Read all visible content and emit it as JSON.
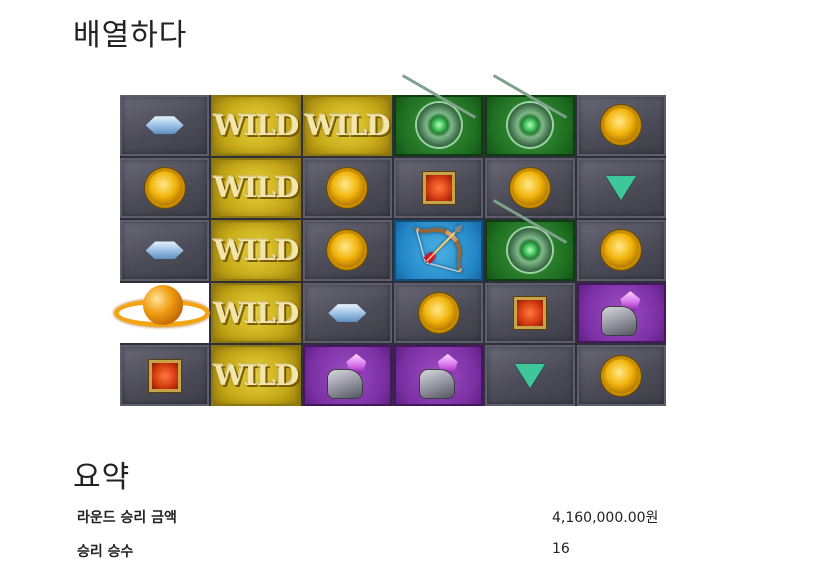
{
  "title": "배열하다",
  "grid": {
    "columns": 6,
    "rows": 5,
    "cells": [
      {
        "symbol": "blue-diamond-icon",
        "bg": "stone"
      },
      {
        "symbol": "wild",
        "label": "WILD",
        "bg": "wild"
      },
      {
        "symbol": "wild",
        "label": "WILD",
        "bg": "wild"
      },
      {
        "symbol": "green-shield-icon",
        "bg": "green"
      },
      {
        "symbol": "green-shield-icon",
        "bg": "green"
      },
      {
        "symbol": "gold-coin-icon",
        "bg": "stone"
      },
      {
        "symbol": "gold-coin-icon",
        "bg": "stone"
      },
      {
        "symbol": "wild",
        "label": "WILD",
        "bg": "wild"
      },
      {
        "symbol": "gold-coin-icon",
        "bg": "stone"
      },
      {
        "symbol": "red-square-gem-icon",
        "bg": "stone"
      },
      {
        "symbol": "gold-coin-icon",
        "bg": "stone"
      },
      {
        "symbol": "green-triangle-gem-icon",
        "bg": "stone"
      },
      {
        "symbol": "blue-diamond-icon",
        "bg": "stone"
      },
      {
        "symbol": "wild",
        "label": "WILD",
        "bg": "wild"
      },
      {
        "symbol": "gold-coin-icon",
        "bg": "stone"
      },
      {
        "symbol": "bow-arrow-icon",
        "bg": "blue"
      },
      {
        "symbol": "green-shield-icon",
        "bg": "green"
      },
      {
        "symbol": "gold-coin-icon",
        "bg": "stone"
      },
      {
        "symbol": "golden-orb-icon",
        "bg": "orb"
      },
      {
        "symbol": "wild",
        "label": "WILD",
        "bg": "wild"
      },
      {
        "symbol": "blue-diamond-icon",
        "bg": "stone"
      },
      {
        "symbol": "gold-coin-icon",
        "bg": "stone"
      },
      {
        "symbol": "red-square-gem-icon",
        "bg": "stone"
      },
      {
        "symbol": "crystal-helmet-icon",
        "bg": "purple"
      },
      {
        "symbol": "red-square-gem-icon",
        "bg": "stone"
      },
      {
        "symbol": "wild",
        "label": "WILD",
        "bg": "wild"
      },
      {
        "symbol": "crystal-helmet-icon",
        "bg": "purple"
      },
      {
        "symbol": "crystal-helmet-icon",
        "bg": "purple"
      },
      {
        "symbol": "green-triangle-gem-icon",
        "bg": "stone"
      },
      {
        "symbol": "gold-coin-icon",
        "bg": "stone"
      }
    ]
  },
  "summary": {
    "heading": "요약",
    "rows": [
      {
        "label": "라운드 승리 금액",
        "value": "4,160,000.00원"
      },
      {
        "label": "승리 승수",
        "value": "16"
      }
    ]
  }
}
